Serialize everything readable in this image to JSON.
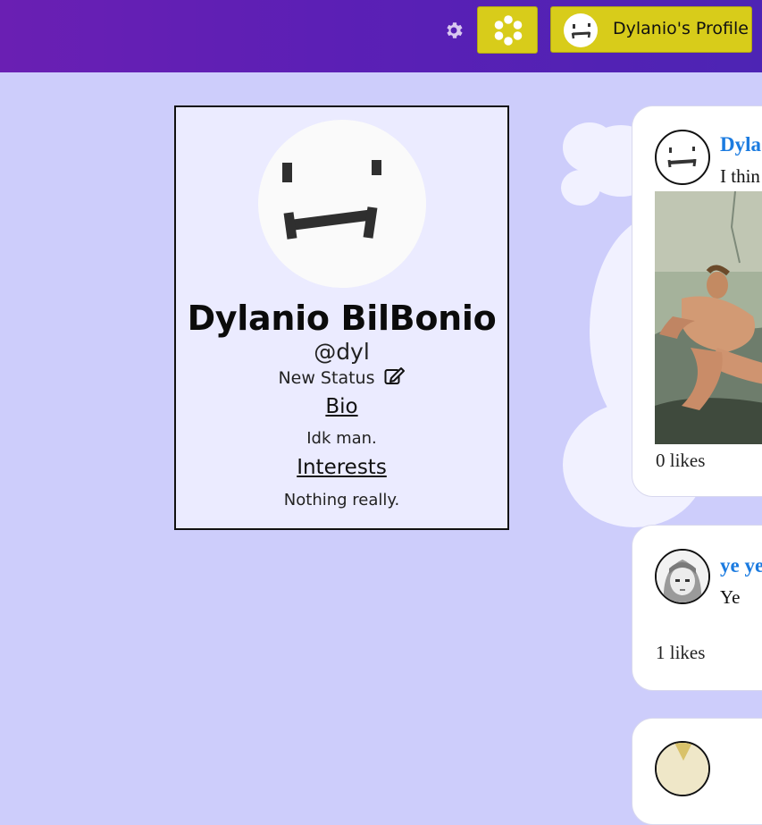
{
  "header": {
    "settings_icon": "gear-icon",
    "home_icon": "flower-icon",
    "profile_button_label": "Dylanio's Profile",
    "accent_color": "#d8cc1a"
  },
  "profile": {
    "name": "Dylanio BilBonio",
    "handle": "@dyl",
    "status_label": "New Status",
    "status_icon": "edit-icon",
    "bio_title": "Bio",
    "bio_text": "Idk man.",
    "interests_title": "Interests",
    "interests_text": "Nothing really."
  },
  "posts": [
    {
      "author": "Dyla",
      "text": "I thin",
      "likes": "0 likes"
    },
    {
      "author": "ye ye",
      "text": "Ye",
      "likes": "1 likes"
    },
    {
      "author": ""
    }
  ]
}
